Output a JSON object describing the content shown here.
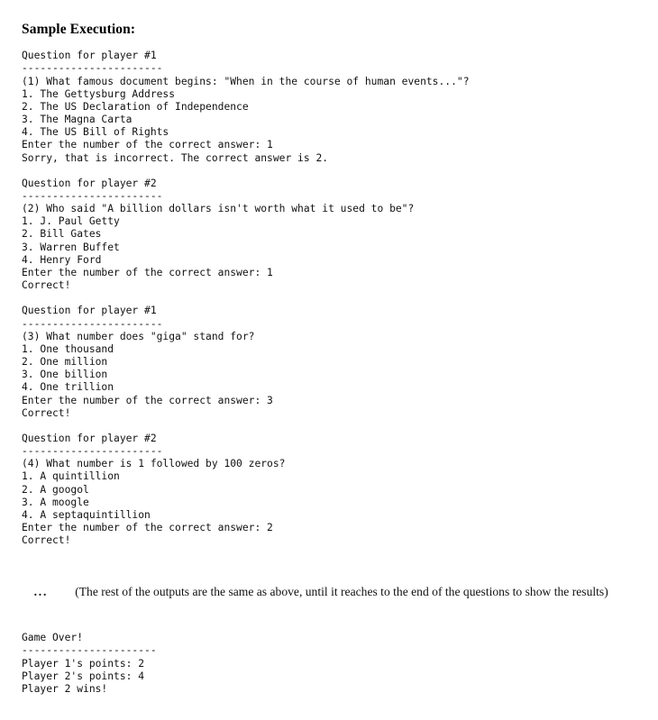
{
  "document": {
    "title": "Sample Execution:",
    "background_color": "#ffffff",
    "text_color": "#111111"
  },
  "console": {
    "separator_long": "-----------------------",
    "separator_short": "----------------------",
    "rounds": [
      {
        "header": "Question for player #1",
        "separator": "-----------------------",
        "question": "(1) What famous document begins: \"When in the course of human events...\"?",
        "choices": [
          "1. The Gettysburg Address",
          "2. The US Declaration of Independence",
          "3. The Magna Carta",
          "4. The US Bill of Rights"
        ],
        "prompt": "Enter the number of the correct answer: 1",
        "result": "Sorry, that is incorrect. The correct answer is 2."
      },
      {
        "header": "Question for player #2",
        "separator": "-----------------------",
        "question": "(2) Who said \"A billion dollars isn't worth what it used to be\"?",
        "choices": [
          "1. J. Paul Getty",
          "2. Bill Gates",
          "3. Warren Buffet",
          "4. Henry Ford"
        ],
        "prompt": "Enter the number of the correct answer: 1",
        "result": "Correct!"
      },
      {
        "header": "Question for player #1",
        "separator": "-----------------------",
        "question": "(3) What number does \"giga\" stand for?",
        "choices": [
          "1. One thousand",
          "2. One million",
          "3. One billion",
          "4. One trillion"
        ],
        "prompt": "Enter the number of the correct answer: 3",
        "result": "Correct!"
      },
      {
        "header": "Question for player #2",
        "separator": "-----------------------",
        "question": "(4) What number is 1 followed by 100 zeros?",
        "choices": [
          "1. A quintillion",
          "2. A googol",
          "3. A moogle",
          "4. A septaquintillion"
        ],
        "prompt": "Enter the number of the correct answer: 2",
        "result": "Correct!"
      }
    ],
    "main_text": "Question for player #1\n-----------------------\n(1) What famous document begins: \"When in the course of human events...\"?\n1. The Gettysburg Address\n2. The US Declaration of Independence\n3. The Magna Carta\n4. The US Bill of Rights\nEnter the number of the correct answer: 1\nSorry, that is incorrect. The correct answer is 2.\n\nQuestion for player #2\n-----------------------\n(2) Who said \"A billion dollars isn't worth what it used to be\"?\n1. J. Paul Getty\n2. Bill Gates\n3. Warren Buffet\n4. Henry Ford\nEnter the number of the correct answer: 1\nCorrect!\n\nQuestion for player #1\n-----------------------\n(3) What number does \"giga\" stand for?\n1. One thousand\n2. One million\n3. One billion\n4. One trillion\nEnter the number of the correct answer: 3\nCorrect!\n\nQuestion for player #2\n-----------------------\n(4) What number is 1 followed by 100 zeros?\n1. A quintillion\n2. A googol\n3. A moogle\n4. A septaquintillion\nEnter the number of the correct answer: 2\nCorrect!"
  },
  "ellipsis_note": {
    "dots": "...",
    "text": "(The rest of the outputs are the same as above, until it reaches to the end of the questions to show the results)"
  },
  "final_block": {
    "header": "Game Over!",
    "separator": "----------------------",
    "player1_points": "Player 1's points: 2",
    "player2_points": "Player 2's points: 4",
    "winner": "Player 2 wins!",
    "text": "Game Over!\n----------------------\nPlayer 1's points: 2\nPlayer 2's points: 4\nPlayer 2 wins!"
  }
}
